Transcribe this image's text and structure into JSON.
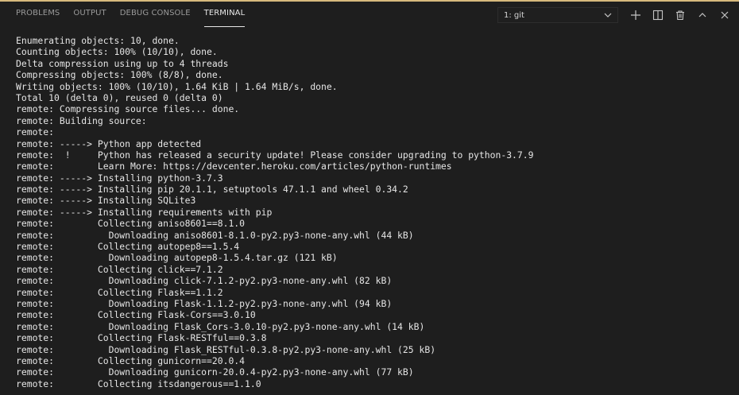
{
  "tabs": [
    {
      "label": "PROBLEMS",
      "active": false
    },
    {
      "label": "OUTPUT",
      "active": false
    },
    {
      "label": "DEBUG CONSOLE",
      "active": false
    },
    {
      "label": "TERMINAL",
      "active": true
    }
  ],
  "terminal_selector": {
    "value": "1: git"
  },
  "actions": [
    {
      "name": "new-terminal",
      "icon": "plus-icon"
    },
    {
      "name": "split-terminal",
      "icon": "split-icon"
    },
    {
      "name": "kill-terminal",
      "icon": "trash-icon"
    },
    {
      "name": "maximize-panel",
      "icon": "chevron-up-icon"
    },
    {
      "name": "close-panel",
      "icon": "close-icon"
    }
  ],
  "colors": {
    "background": "#1e1e1e",
    "text": "#e6e6e6",
    "tab_inactive": "#9a9a9a",
    "tab_active": "#e7e7e7",
    "accent": "#d7ba7d"
  },
  "terminal": {
    "lines": [
      "Enumerating objects: 10, done.",
      "Counting objects: 100% (10/10), done.",
      "Delta compression using up to 4 threads",
      "Compressing objects: 100% (8/8), done.",
      "Writing objects: 100% (10/10), 1.64 KiB | 1.64 MiB/s, done.",
      "Total 10 (delta 0), reused 0 (delta 0)",
      "remote: Compressing source files... done.",
      "remote: Building source:",
      "remote:",
      "remote: -----> Python app detected",
      "remote:  !     Python has released a security update! Please consider upgrading to python-3.7.9",
      "remote:        Learn More: https://devcenter.heroku.com/articles/python-runtimes",
      "remote: -----> Installing python-3.7.3",
      "remote: -----> Installing pip 20.1.1, setuptools 47.1.1 and wheel 0.34.2",
      "remote: -----> Installing SQLite3",
      "remote: -----> Installing requirements with pip",
      "remote:        Collecting aniso8601==8.1.0",
      "remote:          Downloading aniso8601-8.1.0-py2.py3-none-any.whl (44 kB)",
      "remote:        Collecting autopep8==1.5.4",
      "remote:          Downloading autopep8-1.5.4.tar.gz (121 kB)",
      "remote:        Collecting click==7.1.2",
      "remote:          Downloading click-7.1.2-py2.py3-none-any.whl (82 kB)",
      "remote:        Collecting Flask==1.1.2",
      "remote:          Downloading Flask-1.1.2-py2.py3-none-any.whl (94 kB)",
      "remote:        Collecting Flask-Cors==3.0.10",
      "remote:          Downloading Flask_Cors-3.0.10-py2.py3-none-any.whl (14 kB)",
      "remote:        Collecting Flask-RESTful==0.3.8",
      "remote:          Downloading Flask_RESTful-0.3.8-py2.py3-none-any.whl (25 kB)",
      "remote:        Collecting gunicorn==20.0.4",
      "remote:          Downloading gunicorn-20.0.4-py2.py3-none-any.whl (77 kB)",
      "remote:        Collecting itsdangerous==1.1.0"
    ]
  }
}
